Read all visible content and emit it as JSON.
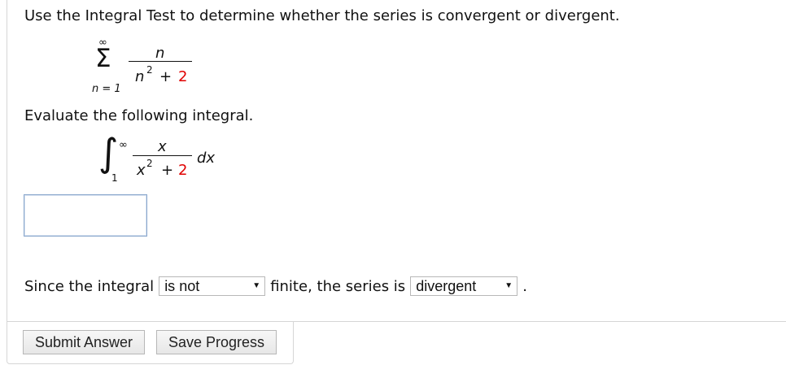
{
  "question": {
    "text": "Use the Integral Test to determine whether the series is convergent or divergent."
  },
  "series": {
    "upper_limit": "∞",
    "summation_symbol": "Σ",
    "numerator": "n",
    "denominator_var": "n",
    "denominator_power": "2",
    "denominator_plus": "+",
    "denominator_constant": "2",
    "lower_limit": "n = 1"
  },
  "evaluate": {
    "prompt": "Evaluate the following integral."
  },
  "integral": {
    "symbol": "∫",
    "upper_limit": "∞",
    "lower_limit": "1",
    "numerator": "x",
    "denominator_var": "x",
    "denominator_power": "2",
    "denominator_plus": "+",
    "denominator_constant": "2",
    "differential": "dx"
  },
  "answer": {
    "value": "",
    "placeholder": ""
  },
  "conclusion": {
    "prefix": "Since the integral",
    "middle": "finite, the series is",
    "suffix": ".",
    "finiteness_select": {
      "selected": "is not"
    },
    "series_select": {
      "selected": "divergent"
    }
  },
  "buttons": {
    "submit_label": "Submit Answer",
    "save_label": "Save Progress"
  },
  "icons": {
    "dropdown": "triangle-down",
    "dropdown_glyph": "▼"
  },
  "colors": {
    "constant_red": "#e00000",
    "input_border": "#89a6cc",
    "button_border": "#b7b7b7"
  }
}
